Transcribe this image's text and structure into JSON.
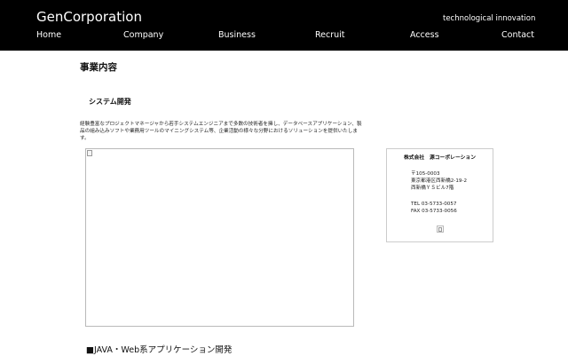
{
  "header": {
    "brand": "GenCorporation",
    "tagline": "technological innovation",
    "nav": [
      "Home",
      "Company",
      "Business",
      "Recruit",
      "Access",
      "Contact"
    ]
  },
  "main": {
    "section_title": "事業内容",
    "sub_title": "システム開発",
    "description": "経験豊富なプロジェクトマネージャから若手システムエンジニアまで多数の技術者を擁し、データベースアプリケーション、製品の組み込みソフトや業務用ツールのマイニングシステム等、企業活動の様々な分野におけるソリューションを提供いたします。",
    "bottom_heading": "■JAVA・Web系アプリケーション開発"
  },
  "company_info": {
    "name": "株式会社　源コーポレーション",
    "address_lines": [
      "〒105-0003",
      "東京都港区西新橋2-19-2",
      "西新橋ＹＳビル7階"
    ],
    "tel": "TEL 03-5733-0057",
    "fax": "FAX 03-5733-0056"
  },
  "colors": {
    "header_bg": "#000000",
    "header_text": "#ffffff",
    "body_bg": "#ffffff"
  },
  "icons": {
    "broken_image": "broken-image-icon"
  }
}
